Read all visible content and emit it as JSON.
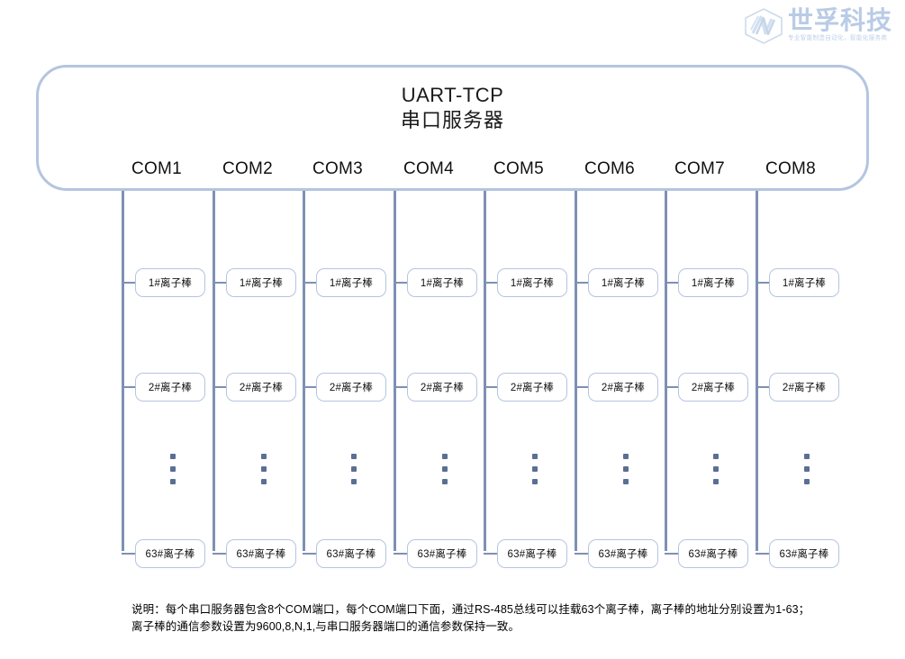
{
  "logo": {
    "mark_icon": "hex-weave-logo-icon",
    "name": "世孚科技",
    "subtitle": "专业智能制造自动化，智能化服务商",
    "color": "#b9cbe6"
  },
  "server": {
    "title": "UART-TCP",
    "subtitle": "串口服务器",
    "border_color": "#b4c5e0"
  },
  "ports": [
    {
      "label": "COM1"
    },
    {
      "label": "COM2"
    },
    {
      "label": "COM3"
    },
    {
      "label": "COM4"
    },
    {
      "label": "COM5"
    },
    {
      "label": "COM6"
    },
    {
      "label": "COM7"
    },
    {
      "label": "COM8"
    }
  ],
  "nodes": {
    "first": "1#离子棒",
    "second": "2#离子棒",
    "ellipsis": "⋮",
    "last": "63#离子棒"
  },
  "bus": {
    "color": "#7e90b4",
    "dot_color": "#5b6e94"
  },
  "caption": {
    "line1": "说明：每个串口服务器包含8个COM端口，每个COM端口下面，通过RS-485总线可以挂载63个离子棒，离子棒的地址分别设置为1-63；",
    "line2": "离子棒的通信参数设置为9600,8,N,1,与串口服务器端口的通信参数保持一致。"
  }
}
